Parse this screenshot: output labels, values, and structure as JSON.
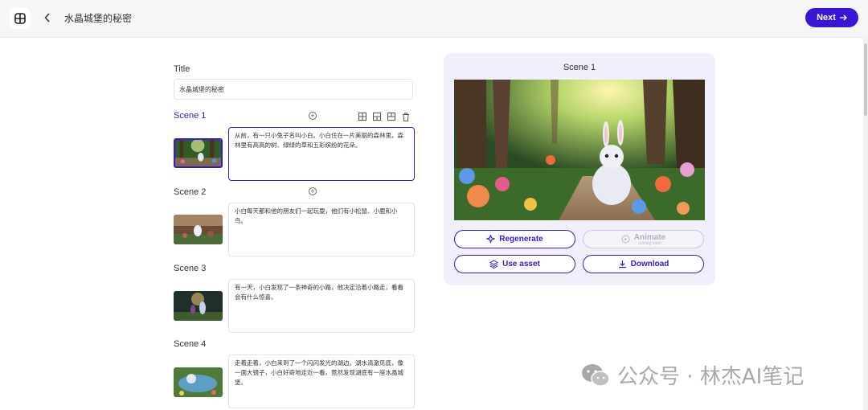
{
  "header": {
    "doc_title": "水晶城堡的秘密",
    "next_label": "Next",
    "logo_icon": "app-logo-icon",
    "back_icon": "chevron-left-icon"
  },
  "form": {
    "title_label": "Title",
    "title_value": "水晶城堡的秘密"
  },
  "scenes": [
    {
      "label": "Scene 1",
      "text": "从前，有一只小兔子名叫小白。小白住在一片美丽的森林里，森林里有高高的树、绿绿的草和五彩缤纷的花朵。",
      "active": true
    },
    {
      "label": "Scene 2",
      "text": "小白每天都和他的朋友们一起玩耍，他们有小松鼠、小鹿和小鸟。",
      "active": false
    },
    {
      "label": "Scene 3",
      "text": "有一天，小白发现了一条神奇的小路，他决定沿着小路走，看看会有什么惊喜。",
      "active": false
    },
    {
      "label": "Scene 4",
      "text": "走着走着，小白来到了一个闪闪发光的湖边。湖水清澈见底，像一面大镜子，小白好奇地走近一看，竟然发现湖底有一座水晶城堡。",
      "active": false
    }
  ],
  "preview": {
    "title": "Scene 1",
    "regenerate_label": "Regenerate",
    "animate_label": "Animate",
    "animate_note": "coming soon",
    "use_asset_label": "Use asset",
    "download_label": "Download"
  },
  "watermark": {
    "text": "公众号 · 林杰AI笔记"
  },
  "colors": {
    "accent": "#3c16d6",
    "panel_bg": "#f1effc"
  }
}
